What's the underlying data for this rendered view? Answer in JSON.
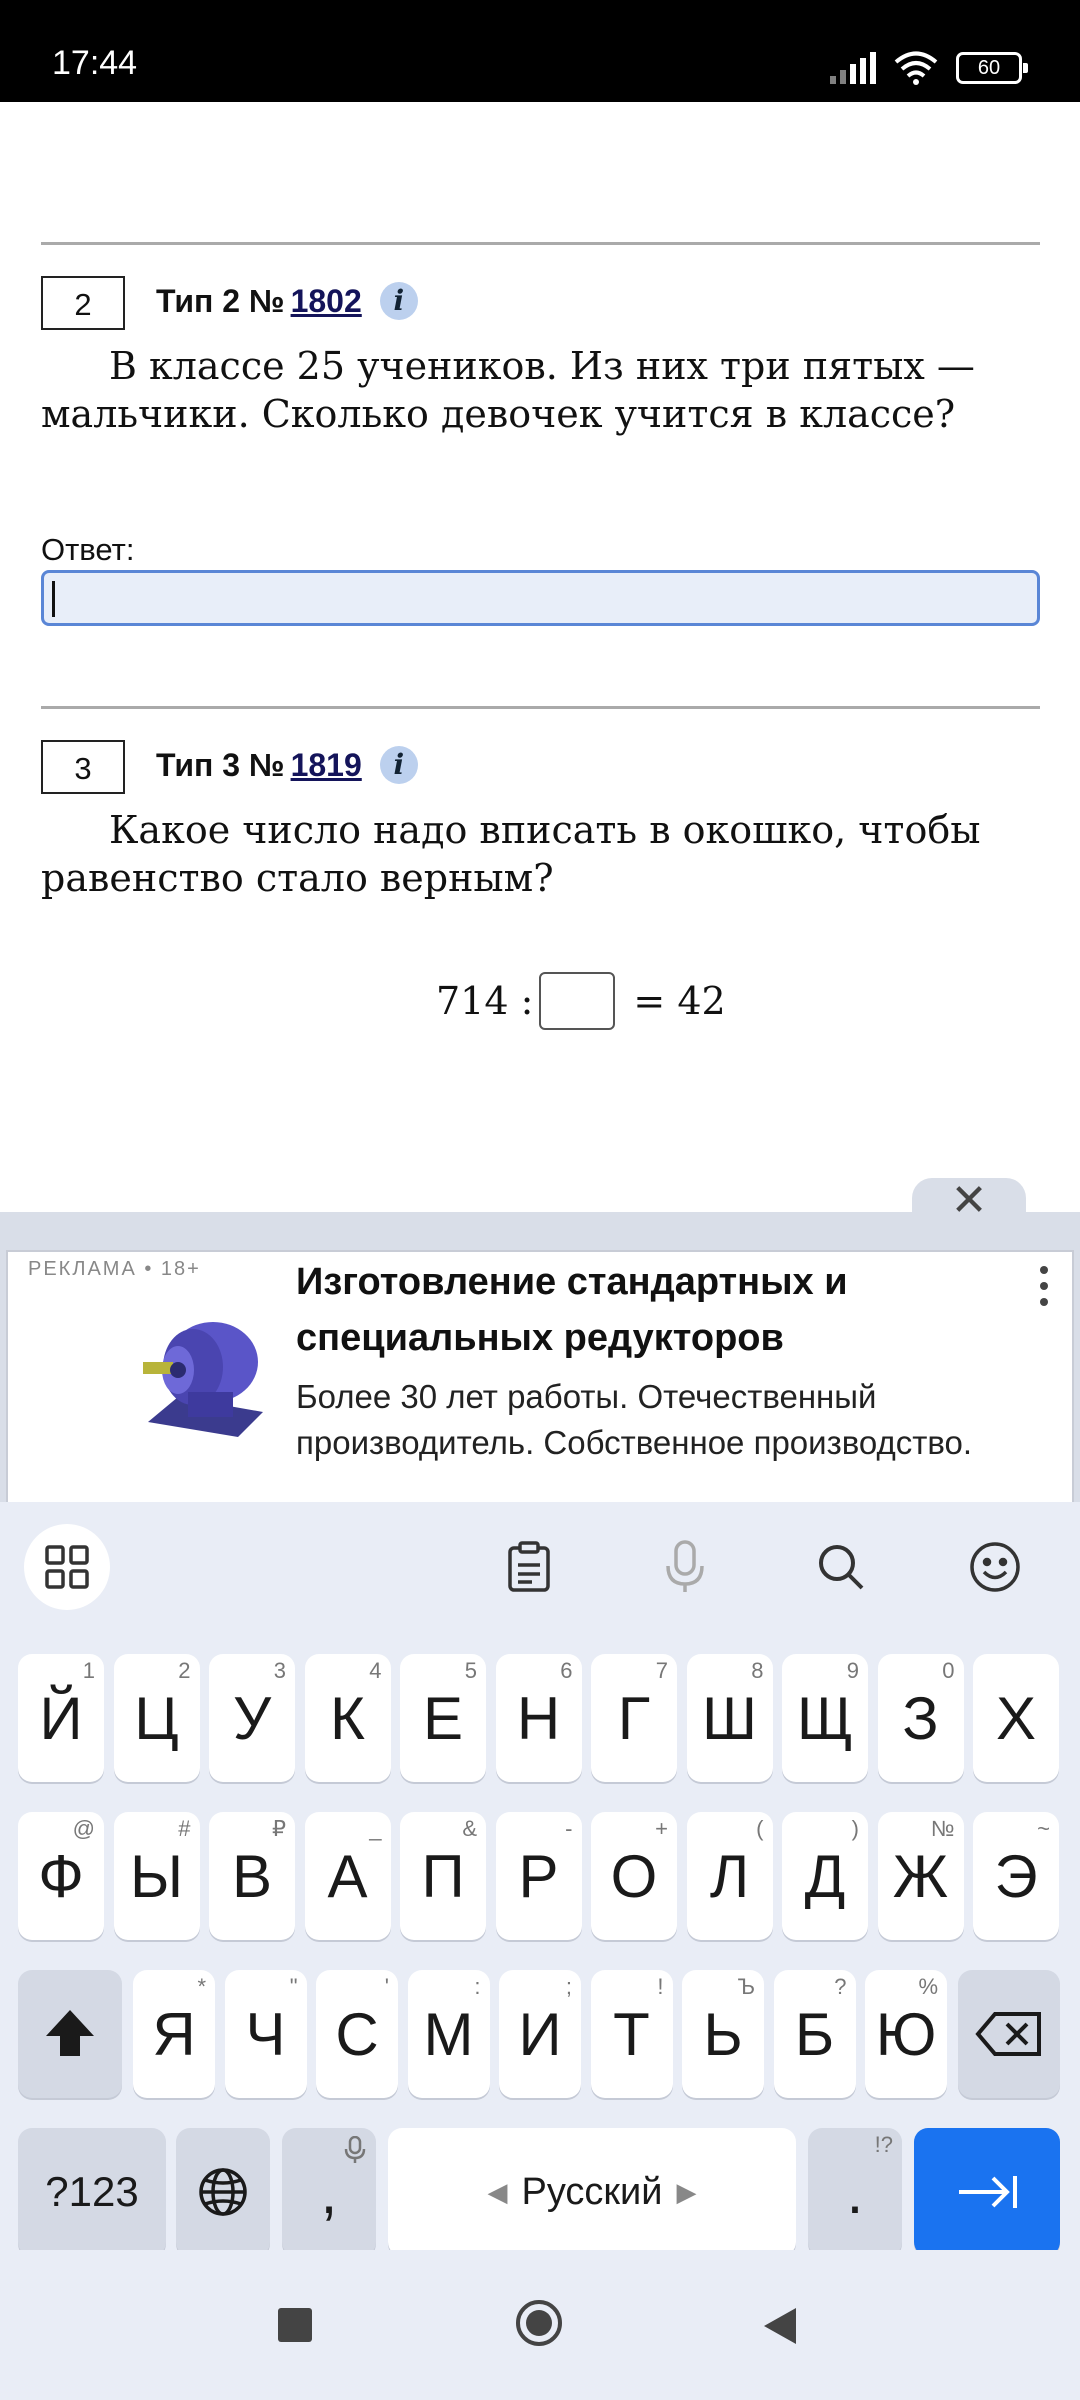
{
  "status_bar": {
    "time": "17:44",
    "battery": "60"
  },
  "task2": {
    "number": "2",
    "type_label": "Тип 2 №",
    "link": "1802",
    "info": "i",
    "text": "В классе 25 учеников. Из них три пятых — мальчики. Сколько девочек учится в классе?",
    "answer_label": "Ответ:"
  },
  "task3": {
    "number": "3",
    "type_label": "Тип 3 №",
    "link": "1819",
    "info": "i",
    "text": "Какое число надо вписать в окошко, чтобы равенство стало верным?",
    "equation_left": "714 :",
    "equation_right": "= 42"
  },
  "ad": {
    "label": "РЕКЛАМА • 18+",
    "title": "Изготовление стандартных и специальных редукторов",
    "body": "Более 30 лет работы. Отечественный производитель. Собственное производство.",
    "close_icon": "close-icon",
    "menu_icon": "more-vertical-icon"
  },
  "keyboard": {
    "row1": [
      [
        "Й",
        "1"
      ],
      [
        "Ц",
        "2"
      ],
      [
        "У",
        "3"
      ],
      [
        "К",
        "4"
      ],
      [
        "Е",
        "5"
      ],
      [
        "Н",
        "6"
      ],
      [
        "Г",
        "7"
      ],
      [
        "Ш",
        "8"
      ],
      [
        "Щ",
        "9"
      ],
      [
        "З",
        "0"
      ],
      [
        "Х",
        ""
      ]
    ],
    "row2": [
      [
        "Ф",
        "@"
      ],
      [
        "Ы",
        "#"
      ],
      [
        "В",
        "₽"
      ],
      [
        "А",
        "_"
      ],
      [
        "П",
        "&"
      ],
      [
        "Р",
        "-"
      ],
      [
        "О",
        "+"
      ],
      [
        "Л",
        "("
      ],
      [
        "Д",
        ")"
      ],
      [
        "Ж",
        "№"
      ],
      [
        "Э",
        "~"
      ]
    ],
    "row3": [
      [
        "Я",
        "*"
      ],
      [
        "Ч",
        "\""
      ],
      [
        "С",
        "'"
      ],
      [
        "М",
        ":"
      ],
      [
        "И",
        ";"
      ],
      [
        "Т",
        "!"
      ],
      [
        "Ь",
        "Ъ"
      ],
      [
        "Б",
        "?"
      ],
      [
        "Ю",
        "%"
      ]
    ],
    "symbols_key": "?123",
    "comma_key": ",",
    "space_label": "Русский",
    "period_key": ".",
    "period_hint": "!?"
  }
}
